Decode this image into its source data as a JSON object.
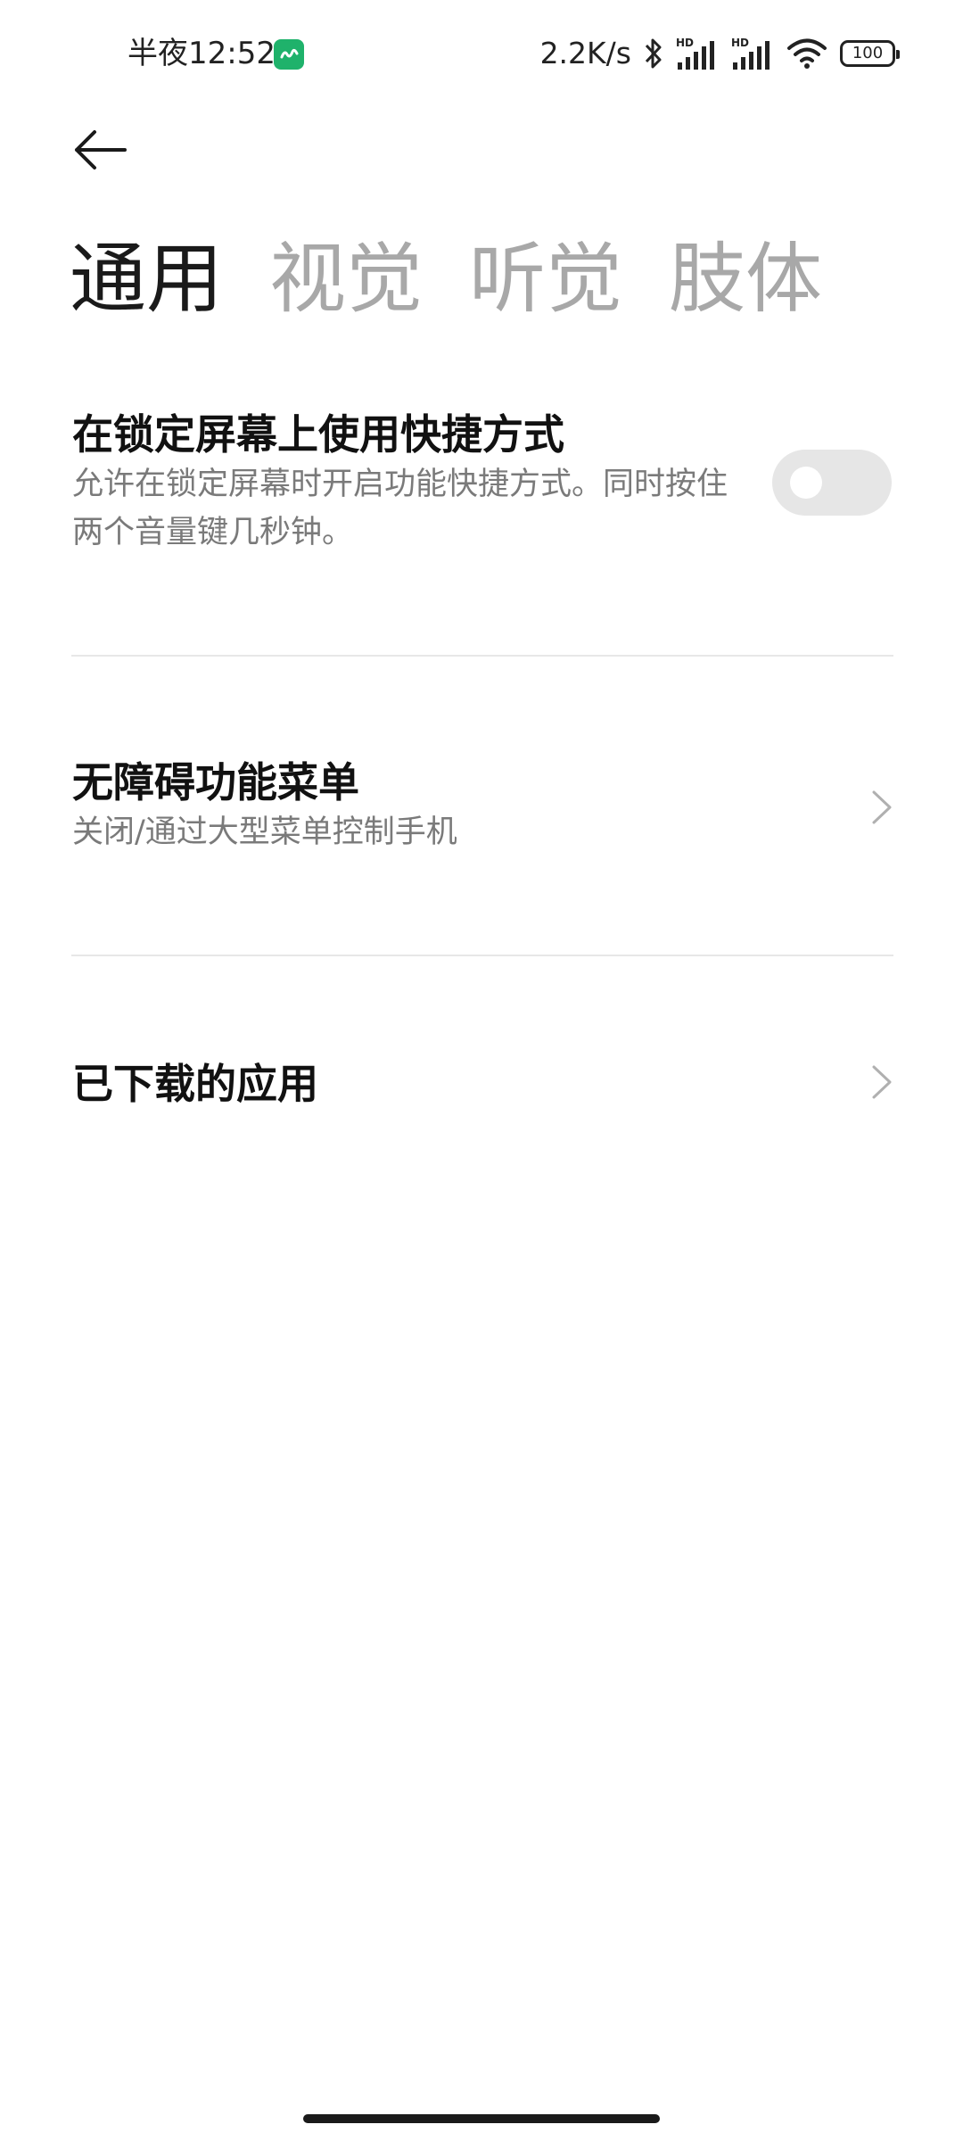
{
  "status_bar": {
    "time": "半夜12:52",
    "app_icon": "green-app-icon",
    "network_speed": "2.2K/s",
    "icons": [
      "bluetooth-icon",
      "signal-hd-icon",
      "signal-hd-icon",
      "wifi-icon"
    ],
    "battery": "100"
  },
  "header": {
    "back_icon": "back-arrow-icon"
  },
  "tabs": [
    {
      "label": "通用",
      "active": true
    },
    {
      "label": "视觉",
      "active": false
    },
    {
      "label": "听觉",
      "active": false
    },
    {
      "label": "肢体",
      "active": false
    }
  ],
  "settings": [
    {
      "title": "在锁定屏幕上使用快捷方式",
      "description": "允许在锁定屏幕时开启功能快捷方式。同时按住两个音量键几秒钟。",
      "control": "toggle",
      "enabled": false
    },
    {
      "title": "无障碍功能菜单",
      "description": "关闭/通过大型菜单控制手机",
      "control": "chevron"
    },
    {
      "title": "已下载的应用",
      "description": "",
      "control": "chevron"
    }
  ],
  "colors": {
    "active_tab": "#1a1a1a",
    "inactive_tab": "#a8a8a8",
    "description": "#7a7a7a",
    "toggle_off": "#e6e6e6",
    "app_icon": "#1fb26b"
  }
}
